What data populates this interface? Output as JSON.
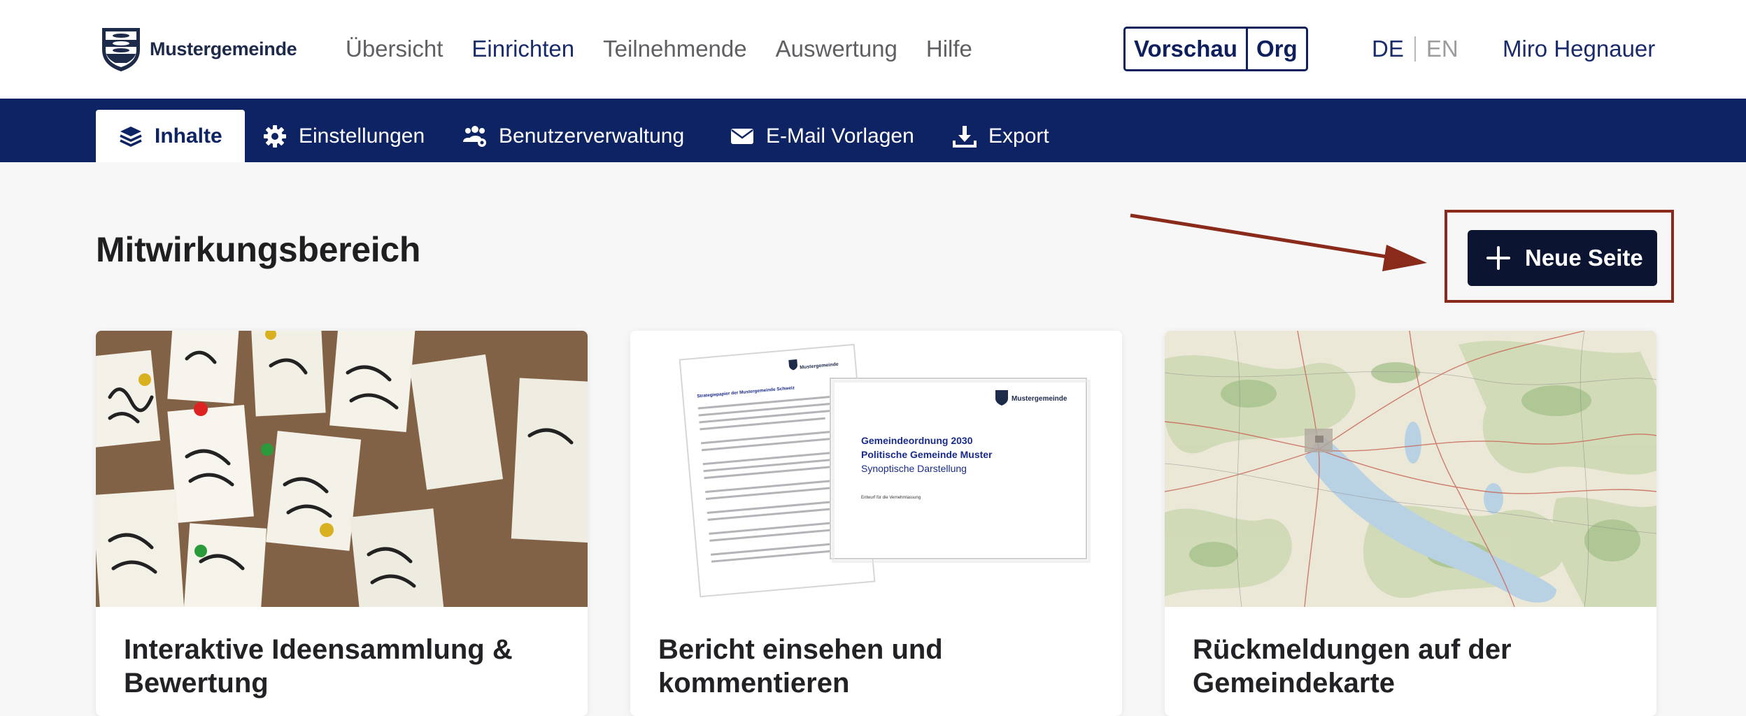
{
  "header": {
    "logo_text": "Mustergemeinde",
    "nav": [
      {
        "label": "Übersicht"
      },
      {
        "label": "Einrichten"
      },
      {
        "label": "Teilnehmende"
      },
      {
        "label": "Auswertung"
      },
      {
        "label": "Hilfe"
      }
    ],
    "preview_toggle": {
      "preview_label": "Vorschau",
      "org_label": "Org"
    },
    "lang": {
      "de": "DE",
      "en": "EN"
    },
    "user_name": "Miro Hegnauer"
  },
  "subnav": {
    "tabs": [
      {
        "label": "Inhalte",
        "icon": "layers-icon"
      },
      {
        "label": "Einstellungen",
        "icon": "gear-icon"
      },
      {
        "label": "Benutzerverwaltung",
        "icon": "users-gear-icon"
      },
      {
        "label": "E-Mail Vorlagen",
        "icon": "envelope-icon"
      },
      {
        "label": "Export",
        "icon": "download-icon"
      }
    ]
  },
  "main": {
    "title": "Mitwirkungsbereich",
    "new_page_label": "Neue Seite",
    "cards": [
      {
        "title": "Interaktive Ideensammlung & Bewertung"
      },
      {
        "title": "Bericht einsehen und kommentieren",
        "doc_back": {
          "header": "Mustergemeinde",
          "title": "Strategiepapier der Mustergemeinde Schweiz"
        },
        "doc_front": {
          "logo": "Mustergemeinde",
          "line1": "Gemeindeordnung 2030",
          "line2": "Politische Gemeinde Muster",
          "line3": "Synoptische Darstellung",
          "note": "Entwurf für die Vernehmlassung"
        }
      },
      {
        "title": "Rückmeldungen auf der Gemeindekarte"
      }
    ]
  },
  "colors": {
    "primary": "#0e2363",
    "dark_button": "#0b1430",
    "annotation": "#8a2a1a"
  }
}
